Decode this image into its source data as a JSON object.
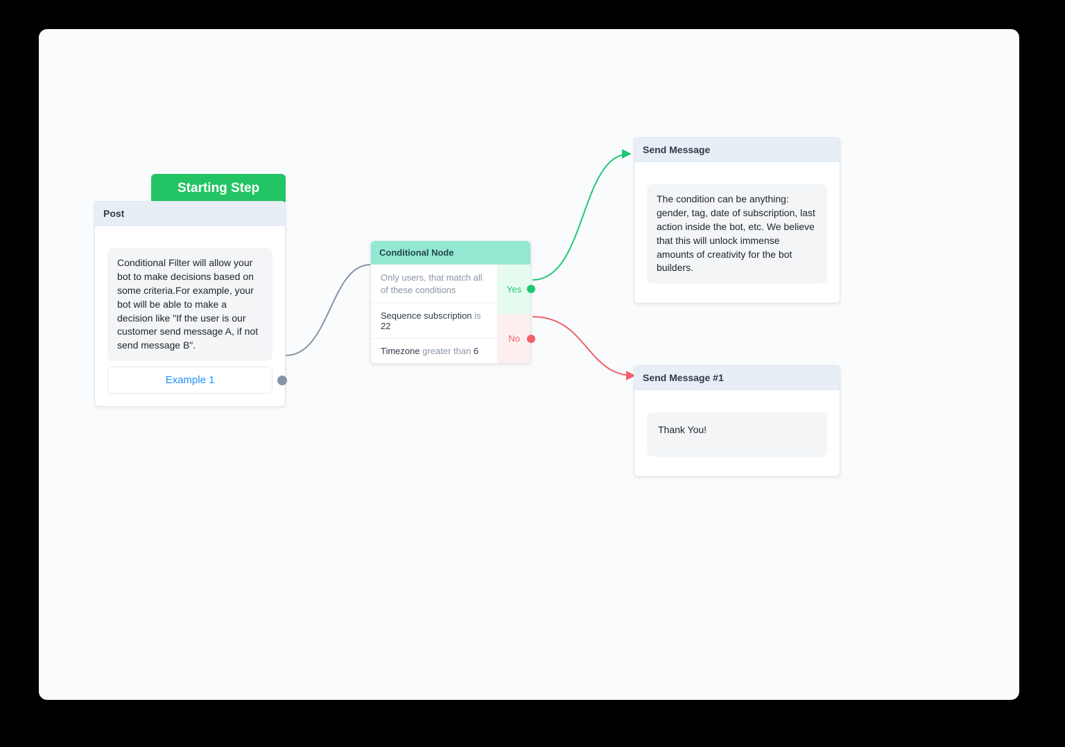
{
  "startingStep": {
    "label": "Starting Step"
  },
  "postNode": {
    "title": "Post",
    "body": "Conditional Filter will allow your bot to make decisions based on some criteria.For example, your bot will be able to make a decision like \"If the user is our customer send message A, if not send message B\".",
    "buttonLabel": "Example 1"
  },
  "conditionalNode": {
    "title": "Conditional Node",
    "intro": "Only users, that match all of these conditions",
    "rule1": {
      "field": "Sequence subscription",
      "op": "is",
      "value": "22"
    },
    "rule2": {
      "field": "Timezone",
      "op": "greater than",
      "value": "6"
    },
    "yesLabel": "Yes",
    "noLabel": "No"
  },
  "sendMessage": {
    "title": "Send Message",
    "body": "The condition can be anything: gender, tag, date of subscription, last action inside the bot, etc. We believe that this will unlock immense amounts of creativity for the bot builders."
  },
  "sendMessage1": {
    "title": "Send Message #1",
    "body": "Thank You!"
  },
  "colors": {
    "pillGreen": "#23c463",
    "yesGreen": "#1ec773",
    "noRed": "#f0606b",
    "wireGray": "#8593a6",
    "linkBlue": "#1990ff",
    "condHeader": "#93e8d2"
  }
}
